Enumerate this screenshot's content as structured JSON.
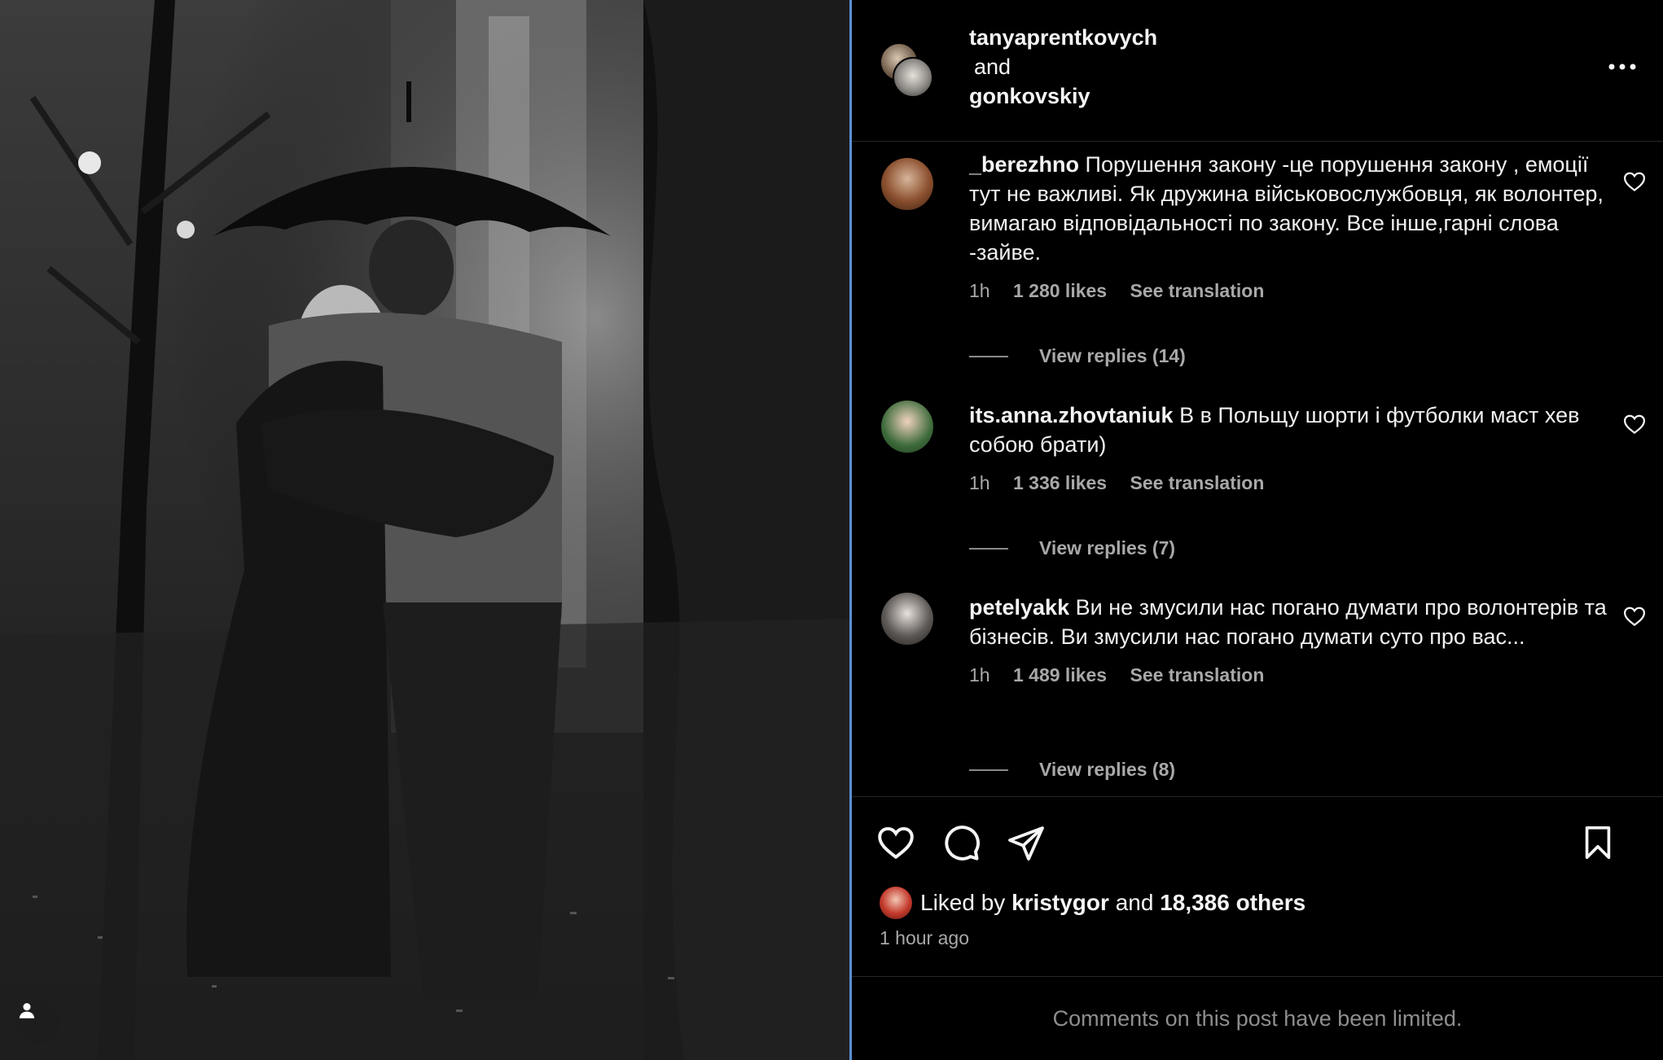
{
  "post": {
    "authors": {
      "first": "tanyaprentkovych",
      "conjunction": "and",
      "second": "gonkovskiy"
    },
    "more_icon": "ellipsis-icon"
  },
  "comments": [
    {
      "username": "_berezhno",
      "text": "Порушення закону -це порушення закону , емоції тут не важливі. Як дружина військовослужбовця, як волонтер, вимагаю відповідальності по закону. Все інше,гарні слова -зайве.",
      "time": "1h",
      "likes": "1 280 likes",
      "translate": "See translation",
      "replies": "View replies (14)"
    },
    {
      "username": "its.anna.zhovtaniuk",
      "text": "В в Польщу шорти і футболки маст хев собою брати)",
      "time": "1h",
      "likes": "1 336 likes",
      "translate": "See translation",
      "replies": "View replies (7)"
    },
    {
      "username": "petelyakk",
      "text": "Ви не змусили нас погано думати про волонтерів та бізнесів. Ви змусили нас погано думати суто про вас...",
      "time": "1h",
      "likes": "1 489 likes",
      "translate": "See translation",
      "replies": "View replies (8)"
    }
  ],
  "likes": {
    "prefix": "Liked by",
    "user": "kristygor",
    "middle": "and",
    "others": "18,386 others"
  },
  "time_ago": "1 hour ago",
  "limited_notice": "Comments on this post have been limited.",
  "icons": [
    "heart-icon",
    "comment-icon",
    "share-icon",
    "bookmark-icon",
    "user-tag-icon"
  ]
}
